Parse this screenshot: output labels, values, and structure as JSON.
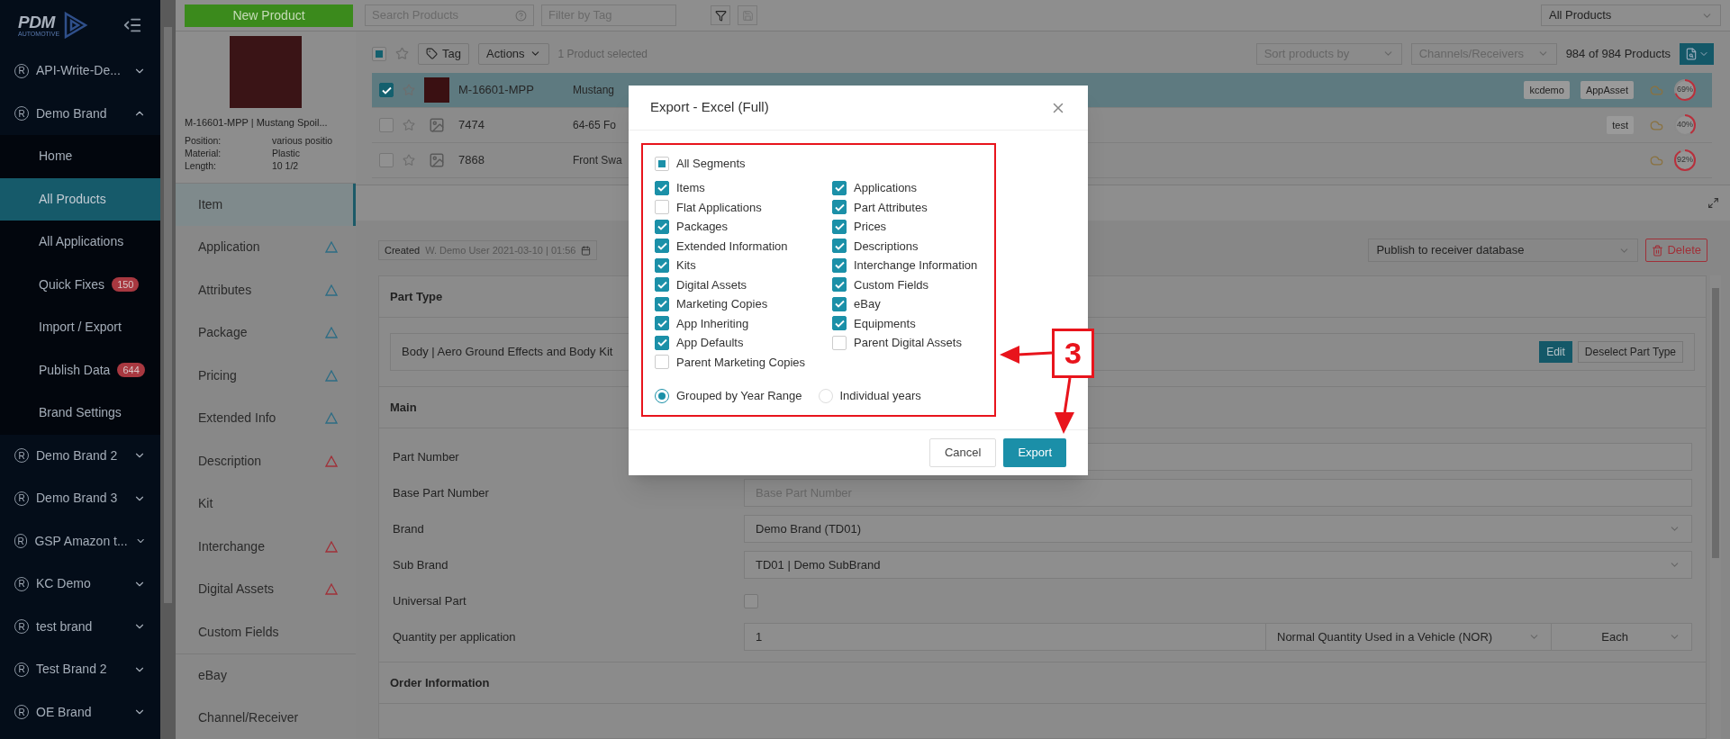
{
  "sidebar": {
    "logo": {
      "name": "PDM",
      "tagline": "AUTOMOTIVE"
    },
    "brands": [
      {
        "icon": "R",
        "label": "API-Write-De...",
        "expanded": false
      },
      {
        "icon": "R",
        "label": "Demo Brand",
        "expanded": true,
        "children": [
          {
            "label": "Home",
            "selected": false
          },
          {
            "label": "All Products",
            "selected": true
          },
          {
            "label": "All Applications",
            "selected": false
          },
          {
            "label": "Quick Fixes",
            "selected": false,
            "badge": "150"
          },
          {
            "label": "Import / Export",
            "selected": false
          },
          {
            "label": "Publish Data",
            "selected": false,
            "badge": "644"
          },
          {
            "label": "Brand Settings",
            "selected": false
          }
        ]
      },
      {
        "icon": "R",
        "label": "Demo Brand 2",
        "expanded": false
      },
      {
        "icon": "R",
        "label": "Demo Brand 3",
        "expanded": false
      },
      {
        "icon": "R",
        "label": "GSP Amazon t...",
        "expanded": false
      },
      {
        "icon": "R",
        "label": "KC Demo",
        "expanded": false
      },
      {
        "icon": "R",
        "label": "test brand",
        "expanded": false
      },
      {
        "icon": "R",
        "label": "Test Brand 2",
        "expanded": false
      },
      {
        "icon": "R",
        "label": "OE Brand",
        "expanded": false
      }
    ]
  },
  "top_bar": {
    "new_product": "New Product",
    "search_placeholder": "Search Products",
    "tag_placeholder": "Filter by Tag",
    "view": "All Products"
  },
  "product_card": {
    "title": "M-16601-MPP | Mustang Spoil...",
    "attributes": [
      {
        "label": "Position:",
        "value": "various positio"
      },
      {
        "label": "Material:",
        "value": "Plastic"
      },
      {
        "label": "Length:",
        "value": "10 1/2"
      }
    ]
  },
  "sections_nav": [
    {
      "label": "Item",
      "selected": true
    },
    {
      "label": "Application",
      "selected": false,
      "color": "#2c6c84"
    },
    {
      "label": "Attributes",
      "selected": false,
      "color": "#2c6c84"
    },
    {
      "label": "Package",
      "selected": false,
      "color": "#2c6c84"
    },
    {
      "label": "Pricing",
      "selected": false,
      "color": "#2c6c84"
    },
    {
      "label": "Extended Info",
      "selected": false,
      "color": "#2c6c84"
    },
    {
      "label": "Description",
      "selected": false,
      "color": "#a03038"
    },
    {
      "label": "Kit",
      "selected": false
    },
    {
      "label": "Interchange",
      "selected": false,
      "color": "#a03038"
    },
    {
      "label": "Digital Assets",
      "selected": false,
      "color": "#a03038"
    },
    {
      "label": "Custom Fields",
      "selected": false
    },
    {
      "label": "eBay",
      "selected": false
    },
    {
      "label": "Channel/Receiver",
      "selected": false
    }
  ],
  "product_list": {
    "select_all": {
      "indeterminate": true
    },
    "tag": "Tag",
    "actions": "Actions",
    "selection": "1 Product selected",
    "sort_placeholder": "Sort products by",
    "channels_placeholder": "Channels/Receivers",
    "count": "984 of 984 Products",
    "rows": [
      {
        "number": "M-16601-MPP",
        "description": "Mustang",
        "selected": true,
        "has_photo": true,
        "tags": [
          "kcdemo",
          "AppAsset"
        ],
        "completeness": "69%"
      },
      {
        "number": "7474",
        "description": "64-65 Fo",
        "selected": false,
        "has_photo": false,
        "tags": [
          "test"
        ],
        "completeness": "40%"
      },
      {
        "number": "7868",
        "description": "Front Swa",
        "selected": false,
        "has_photo": false,
        "tags": [],
        "completeness": "92%"
      }
    ]
  },
  "detail": {
    "created_label": "Created",
    "created_value": "W. Demo User 2021-03-10 | 01:56",
    "publish": "Publish to receiver database",
    "delete": "Delete",
    "part_type": {
      "title": "Part Type",
      "value": "Body | Aero Ground Effects and Body Kit",
      "edit": "Edit",
      "deselect": "Deselect Part Type"
    },
    "main": {
      "title": "Main",
      "fields": [
        {
          "label": "Part Number",
          "kind": "text"
        },
        {
          "label": "Base Part Number",
          "kind": "text",
          "placeholder": "Base Part Number"
        },
        {
          "label": "Brand",
          "kind": "select",
          "value": "Demo Brand (TD01)"
        },
        {
          "label": "Sub Brand",
          "kind": "select",
          "value": "TD01 | Demo SubBrand"
        },
        {
          "label": "Universal Part",
          "kind": "checkbox",
          "checked": false
        },
        {
          "label": "Quantity per application",
          "kind": "quantity",
          "value": "1",
          "code": "Normal Quantity Used in a Vehicle (NOR)",
          "unit": "Each"
        }
      ]
    },
    "order_info": {
      "title": "Order Information"
    }
  },
  "modal": {
    "title": "Export - Excel (Full)",
    "all_segments": {
      "label": "All Segments",
      "checked": false,
      "indeterminate": true
    },
    "columns": [
      [
        {
          "label": "Items",
          "checked": true
        },
        {
          "label": "Flat Applications",
          "checked": false
        },
        {
          "label": "Packages",
          "checked": true
        },
        {
          "label": "Extended Information",
          "checked": true
        },
        {
          "label": "Kits",
          "checked": true
        },
        {
          "label": "Digital Assets",
          "checked": true
        },
        {
          "label": "Marketing Copies",
          "checked": true
        },
        {
          "label": "App Inheriting",
          "checked": true
        },
        {
          "label": "App Defaults",
          "checked": true
        },
        {
          "label": "Parent Marketing Copies",
          "checked": false
        }
      ],
      [
        {
          "label": "Applications",
          "checked": true
        },
        {
          "label": "Part Attributes",
          "checked": true
        },
        {
          "label": "Prices",
          "checked": true
        },
        {
          "label": "Descriptions",
          "checked": true
        },
        {
          "label": "Interchange Information",
          "checked": true
        },
        {
          "label": "Custom Fields",
          "checked": true
        },
        {
          "label": "eBay",
          "checked": true
        },
        {
          "label": "Equipments",
          "checked": true
        },
        {
          "label": "Parent Digital Assets",
          "checked": false
        }
      ]
    ],
    "year_modes": [
      {
        "label": "Grouped by Year Range",
        "selected": true
      },
      {
        "label": "Individual years",
        "selected": false
      }
    ],
    "cancel": "Cancel",
    "export": "Export"
  },
  "annotation": {
    "step": "3"
  }
}
